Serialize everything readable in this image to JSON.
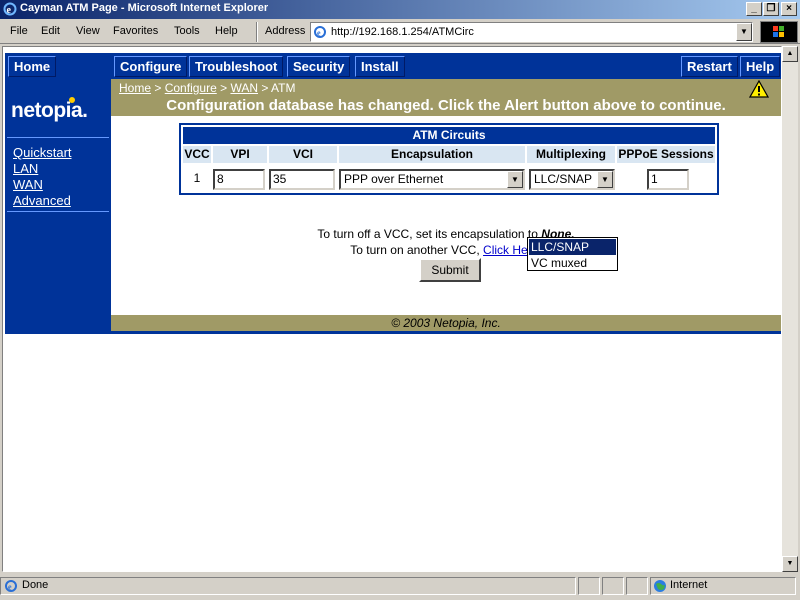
{
  "window": {
    "title": "Cayman ATM Page - Microsoft Internet Explorer"
  },
  "menu": {
    "items": [
      "File",
      "Edit",
      "View",
      "Favorites",
      "Tools",
      "Help"
    ],
    "address_label": "Address",
    "url": "http://192.168.1.254/ATMCirc"
  },
  "nav": {
    "tabs": [
      "Home",
      "Configure",
      "Troubleshoot",
      "Security",
      "Install",
      "Restart",
      "Help"
    ]
  },
  "sidebar": {
    "logo": "netopia.",
    "links": [
      "Quickstart",
      "LAN",
      "WAN",
      "Advanced"
    ]
  },
  "breadcrumb": {
    "items": [
      "Home",
      "Configure",
      "WAN"
    ],
    "current": "ATM",
    "separator": ">"
  },
  "alert": {
    "message": "Configuration database has changed. Click the Alert button above to continue."
  },
  "atm": {
    "title": "ATM Circuits",
    "headers": [
      "VCC",
      "VPI",
      "VCI",
      "Encapsulation",
      "Multiplexing",
      "PPPoE Sessions"
    ],
    "row": {
      "vcc": "1",
      "vpi": "8",
      "vci": "35",
      "encapsulation": "PPP over Ethernet",
      "multiplexing": "LLC/SNAP",
      "pppoe_sessions": "1"
    },
    "multiplexing_options": [
      "LLC/SNAP",
      "VC muxed"
    ]
  },
  "notes": {
    "line1_prefix": "To turn off a VCC, set its encapsulation to ",
    "line1_value": "None.",
    "line2_prefix": "To turn on another VCC, ",
    "line2_link": "Click Here."
  },
  "form": {
    "submit_label": "Submit"
  },
  "footer": {
    "text": "© 2003 Netopia, Inc."
  },
  "status": {
    "text": "Done",
    "zone": "Internet"
  },
  "colors": {
    "nav_blue": "#003399",
    "banner_olive": "#a09a66",
    "header_light_blue": "#d9e6f2",
    "titlebar_dark": "#0a246a"
  }
}
